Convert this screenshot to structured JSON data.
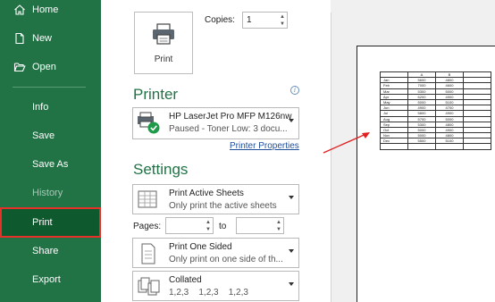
{
  "sidebar": {
    "items": [
      {
        "label": "Home",
        "icon": "home-icon"
      },
      {
        "label": "New",
        "icon": "new-document-icon"
      },
      {
        "label": "Open",
        "icon": "open-folder-icon"
      },
      {
        "label": "Info"
      },
      {
        "label": "Save"
      },
      {
        "label": "Save As"
      },
      {
        "label": "History",
        "disabled": true
      },
      {
        "label": "Print",
        "active": true
      },
      {
        "label": "Share"
      },
      {
        "label": "Export"
      }
    ]
  },
  "print": {
    "button_label": "Print",
    "copies_label": "Copies:",
    "copies_value": "1"
  },
  "printer": {
    "heading": "Printer",
    "name": "HP LaserJet Pro MFP M126nw",
    "status": "Paused - Toner Low: 3 docu...",
    "properties_link": "Printer Properties"
  },
  "settings": {
    "heading": "Settings",
    "print_what": {
      "title": "Print Active Sheets",
      "subtitle": "Only print the active sheets"
    },
    "pages_label": "Pages:",
    "pages_from": "",
    "to_label": "to",
    "pages_to": "",
    "sides": {
      "title": "Print One Sided",
      "subtitle": "Only print on one side of th..."
    },
    "collation": {
      "title": "Collated",
      "subtitle": "1,2,3    1,2,3    1,2,3"
    }
  },
  "preview": {
    "headers": [
      "",
      "A",
      "B",
      ""
    ],
    "rows": [
      [
        "Jan",
        "5600",
        "4800",
        ""
      ],
      [
        "Feb",
        "7000",
        "4600",
        ""
      ],
      [
        "Mar",
        "5300",
        "5000",
        ""
      ],
      [
        "Apr",
        "6200",
        "4900",
        ""
      ],
      [
        "May",
        "5000",
        "5100",
        ""
      ],
      [
        "Jun",
        "4900",
        "4700",
        ""
      ],
      [
        "Jul",
        "5800",
        "4900",
        ""
      ],
      [
        "Aug",
        "5700",
        "5000",
        ""
      ],
      [
        "Sep",
        "5300",
        "4800",
        ""
      ],
      [
        "Oct",
        "5000",
        "4900",
        ""
      ],
      [
        "Nov",
        "5000",
        "4800",
        ""
      ],
      [
        "Dec",
        "5500",
        "5100",
        ""
      ],
      [
        "",
        "",
        "",
        ""
      ]
    ]
  },
  "colors": {
    "brand": "#217346",
    "active_border": "#e8302a",
    "arrow": "#e02020"
  }
}
